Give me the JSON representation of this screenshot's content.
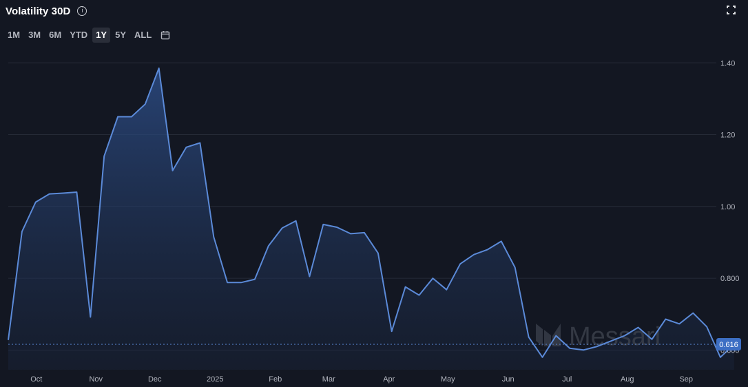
{
  "title": "Volatility 30D",
  "info_icon": "info-icon",
  "expand_icon": "expand-icon",
  "calendar_icon": "calendar-icon",
  "ranges": [
    {
      "label": "1M",
      "active": false
    },
    {
      "label": "3M",
      "active": false
    },
    {
      "label": "6M",
      "active": false
    },
    {
      "label": "YTD",
      "active": false
    },
    {
      "label": "1Y",
      "active": true
    },
    {
      "label": "5Y",
      "active": false
    },
    {
      "label": "ALL",
      "active": false
    }
  ],
  "watermark": "Messari",
  "colors": {
    "background": "#131722",
    "line": "#5b8ad8",
    "grid": "#262b38",
    "axis_text": "#b2b5be",
    "badge": "#3d6fc4"
  },
  "chart_data": {
    "type": "area",
    "current_value": 0.616,
    "current_label": "0.616",
    "ylim": [
      0.545,
      1.46
    ],
    "yticks": [
      {
        "value": 1.4,
        "label": "1.40"
      },
      {
        "value": 1.2,
        "label": "1.20"
      },
      {
        "value": 1.0,
        "label": "1.00"
      },
      {
        "value": 0.8,
        "label": "0.800"
      },
      {
        "value": 0.6,
        "label": "0.600"
      }
    ],
    "xlim": [
      0,
      51.5
    ],
    "xticks": [
      {
        "pos": 2.05,
        "label": "Oct"
      },
      {
        "pos": 6.4,
        "label": "Nov"
      },
      {
        "pos": 10.7,
        "label": "Dec"
      },
      {
        "pos": 15.1,
        "label": "2025"
      },
      {
        "pos": 19.5,
        "label": "Feb"
      },
      {
        "pos": 23.4,
        "label": "Mar"
      },
      {
        "pos": 27.8,
        "label": "Apr"
      },
      {
        "pos": 32.1,
        "label": "May"
      },
      {
        "pos": 36.5,
        "label": "Jun"
      },
      {
        "pos": 40.8,
        "label": "Jul"
      },
      {
        "pos": 45.2,
        "label": "Aug"
      },
      {
        "pos": 49.5,
        "label": "Sep"
      }
    ],
    "values": [
      0.628,
      0.93,
      1.012,
      1.035,
      1.037,
      1.04,
      0.692,
      1.14,
      1.25,
      1.25,
      1.285,
      1.385,
      1.1,
      1.165,
      1.177,
      0.915,
      0.788,
      0.788,
      0.797,
      0.89,
      0.94,
      0.96,
      0.805,
      0.95,
      0.942,
      0.924,
      0.927,
      0.87,
      0.652,
      0.776,
      0.753,
      0.8,
      0.768,
      0.84,
      0.866,
      0.88,
      0.903,
      0.83,
      0.636,
      0.58,
      0.64,
      0.605,
      0.6,
      0.61,
      0.625,
      0.64,
      0.663,
      0.63,
      0.686,
      0.673,
      0.703,
      0.665,
      0.58,
      0.616
    ]
  }
}
